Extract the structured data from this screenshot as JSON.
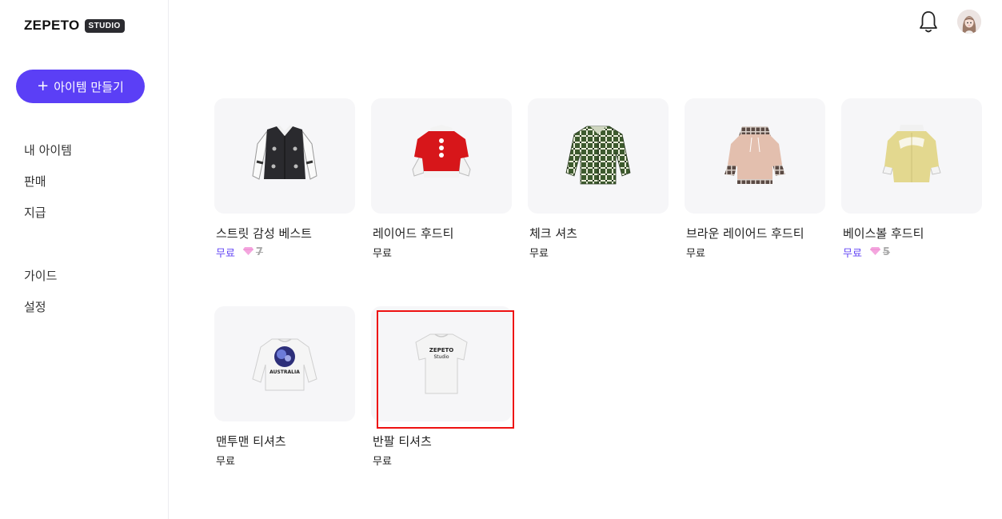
{
  "brand": {
    "name": "ZEPETO",
    "badge": "STUDIO"
  },
  "sidebar": {
    "create_button": {
      "label": "아이템 만들기"
    },
    "nav_primary": [
      "내 아이템",
      "판매",
      "지급"
    ],
    "nav_secondary": [
      "가이드",
      "설정"
    ]
  },
  "colors": {
    "accent": "#5b3ff6",
    "free_highlight": "#6547f5",
    "selection": "#e11111"
  },
  "topbar": {
    "icons": [
      "bell-icon",
      "avatar"
    ]
  },
  "items": [
    {
      "name": "스트릿 감성 베스트",
      "price": "무료",
      "highlight": true,
      "old_price": "7"
    },
    {
      "name": "레이어드 후드티",
      "price": "무료",
      "highlight": false
    },
    {
      "name": "체크 셔츠",
      "price": "무료",
      "highlight": false
    },
    {
      "name": "브라운 레이어드 후드티",
      "price": "무료",
      "highlight": false
    },
    {
      "name": "베이스볼 후드티",
      "price": "무료",
      "highlight": true,
      "old_price": "5"
    },
    {
      "name": "맨투맨 티셔츠",
      "price": "무료",
      "highlight": false,
      "print": "AUSTRALIA"
    },
    {
      "name": "반팔 티셔츠",
      "price": "무료",
      "highlight": false,
      "print_line1": "ZEPETO",
      "print_line2": "Studio",
      "selected": true
    }
  ]
}
